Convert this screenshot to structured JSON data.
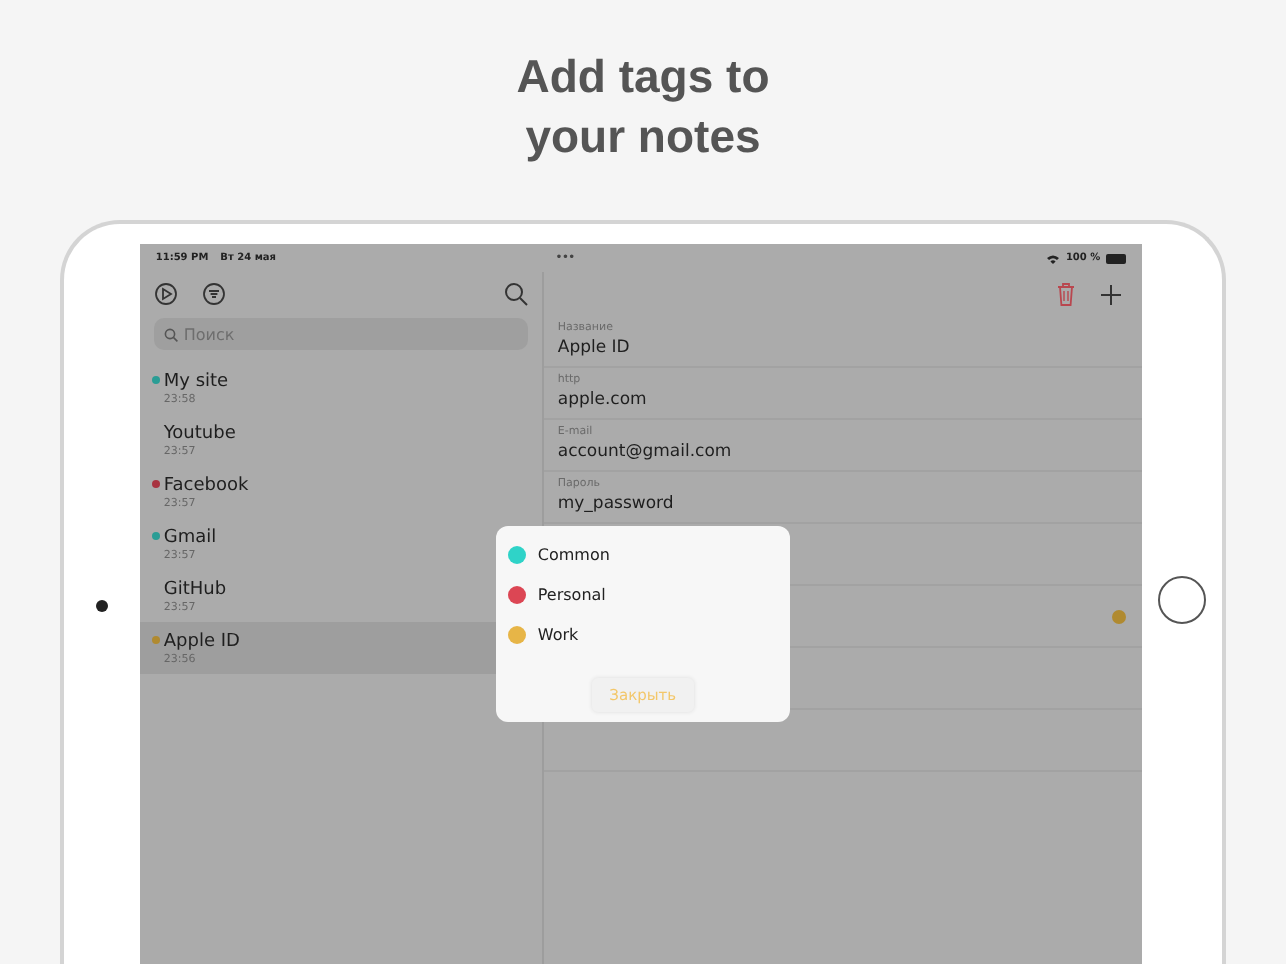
{
  "headline": [
    "Add tags to",
    "your notes"
  ],
  "status_bar": {
    "time": "11:59 PM",
    "date": "Вт 24 мая",
    "dots": "•••",
    "battery": "100 %"
  },
  "sidebar": {
    "search": {
      "placeholder": "Поиск"
    },
    "items": [
      {
        "title": "My site",
        "time": "23:58",
        "color": "#2a9d95",
        "selected": false
      },
      {
        "title": "Youtube",
        "time": "23:57",
        "selected": false
      },
      {
        "title": "Facebook",
        "time": "23:57",
        "color": "#a83340",
        "selected": false
      },
      {
        "title": "Gmail",
        "time": "23:57",
        "color": "#2a9d95",
        "selected": false
      },
      {
        "title": "GitHub",
        "time": "23:57",
        "selected": false
      },
      {
        "title": "Apple ID",
        "time": "23:56",
        "color": "#b08a30",
        "selected": true
      }
    ]
  },
  "detail": {
    "fields": [
      {
        "label": "Название",
        "value": "Apple ID"
      },
      {
        "label": "http",
        "value": "apple.com"
      },
      {
        "label": "E-mail",
        "value": "account@gmail.com"
      },
      {
        "label": "Пароль",
        "value": "my_password"
      }
    ],
    "tag_row": {
      "color": "#b08a30"
    }
  },
  "popup": {
    "tags": [
      {
        "name": "Common",
        "color": "#2fd3c8"
      },
      {
        "name": "Personal",
        "color": "#dc4654"
      },
      {
        "name": "Work",
        "color": "#e7b547"
      }
    ],
    "button": "Закрыть"
  }
}
